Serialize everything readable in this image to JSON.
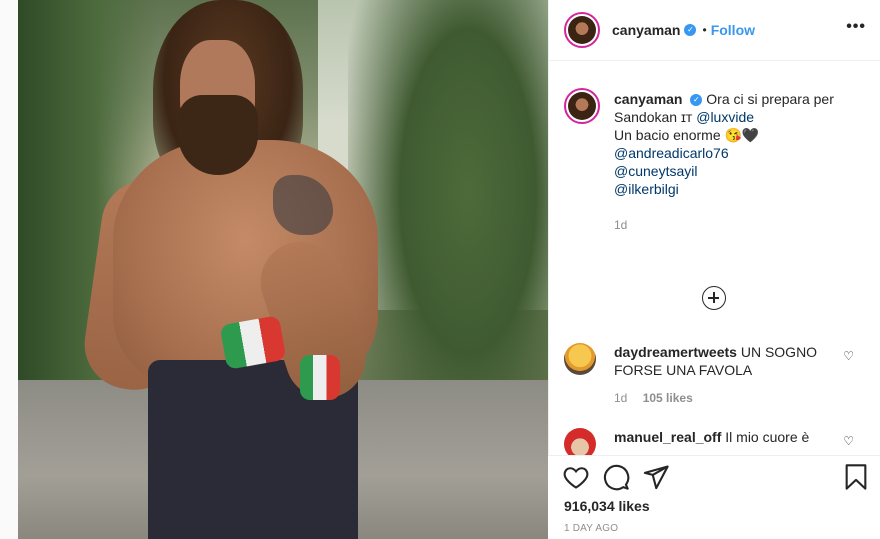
{
  "post": {
    "username": "canyaman",
    "follow_label": "Follow",
    "dot": "•",
    "more": "•••"
  },
  "caption": {
    "username": "canyaman",
    "line1": "Ora ci si prepara per",
    "line2_text": "Sandokan ɪᴛ ",
    "line2_mention": "@luxvide",
    "line3": "Un bacio enorme 😘🖤",
    "mentions": [
      "@andreadicarlo76",
      "@cuneytsayil",
      "@ilkerbilgi"
    ],
    "time": "1d"
  },
  "comments": [
    {
      "username": "daydreamertweets",
      "text": "UN SOGNO FORSE UNA FAVOLA",
      "time": "1d",
      "likes": "105 likes"
    },
    {
      "username": "manuel_real_off",
      "text": "Il mio cuore è"
    }
  ],
  "actions": {
    "likes": "916,034 likes",
    "ago": "1 DAY AGO"
  },
  "icons": {
    "like": "heart-icon",
    "comment": "comment-icon",
    "share": "share-icon",
    "save": "bookmark-icon",
    "add_comment": "add-circle-icon",
    "verified": "verified-badge-icon"
  },
  "colors": {
    "accent": "#3897f0",
    "mention": "#00376b",
    "muted": "#8e8e8e",
    "story_ring": "#d6249f"
  }
}
